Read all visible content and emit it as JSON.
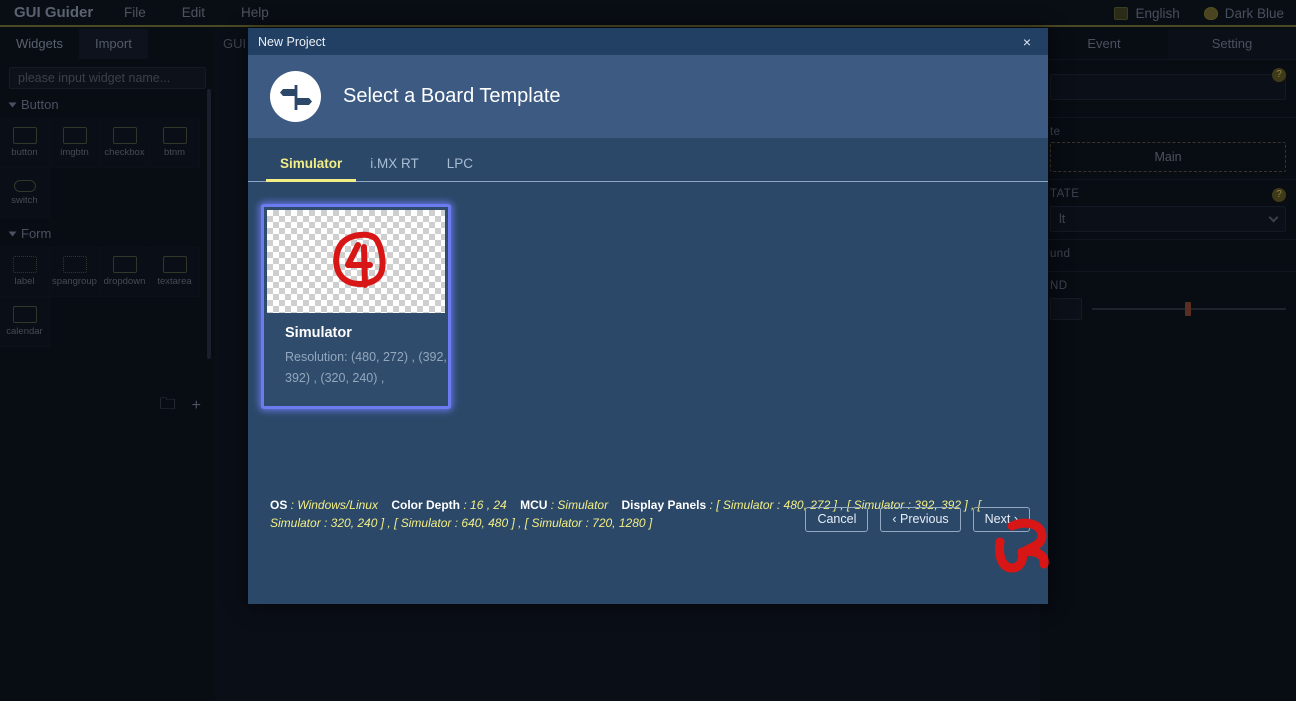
{
  "menubar": {
    "brand": "GUI Guider",
    "items": [
      "File",
      "Edit",
      "Help"
    ],
    "language": {
      "label": "English",
      "icon": "language-icon"
    },
    "theme": {
      "label": "Dark Blue",
      "icon": "palette-icon"
    }
  },
  "left_panel": {
    "tabs": [
      {
        "label": "Widgets",
        "active": true
      },
      {
        "label": "Import",
        "active": false
      }
    ],
    "search_placeholder": "please input widget name...",
    "groups": [
      {
        "name": "Button",
        "widgets": [
          {
            "label": "button",
            "icon": "button-icon"
          },
          {
            "label": "imgbtn",
            "icon": "imgbtn-icon"
          },
          {
            "label": "checkbox",
            "icon": "checkbox-icon"
          },
          {
            "label": "btnm",
            "icon": "btnm-icon"
          },
          {
            "label": "switch",
            "icon": "switch-icon"
          }
        ]
      },
      {
        "name": "Form",
        "widgets": [
          {
            "label": "label",
            "icon": "label-icon"
          },
          {
            "label": "spangroup",
            "icon": "spangroup-icon"
          },
          {
            "label": "dropdown",
            "icon": "dropdown-icon"
          },
          {
            "label": "textarea",
            "icon": "textarea-icon"
          },
          {
            "label": "calendar",
            "icon": "calendar-icon"
          }
        ]
      }
    ],
    "footer_icons": [
      {
        "name": "open-folder-icon",
        "glyph": "🗀"
      },
      {
        "name": "add-icon",
        "glyph": "+"
      }
    ]
  },
  "canvas": {
    "tab_label": "GUI"
  },
  "right_panel": {
    "tabs": [
      {
        "label": "Event",
        "active": false
      },
      {
        "label": "Setting",
        "active": true
      }
    ],
    "fields": [
      {
        "label": "",
        "type": "input",
        "help": "?"
      },
      {
        "label": "te",
        "type": "dashed",
        "value": "Main"
      },
      {
        "label": "TATE",
        "type": "select",
        "value": "lt",
        "help": "?"
      },
      {
        "label": "und",
        "type": "text"
      },
      {
        "label": "ND",
        "type": "slider"
      }
    ]
  },
  "dialog": {
    "window_title": "New Project",
    "close_label": "×",
    "header_title": "Select a Board Template",
    "header_icon": "signpost-icon",
    "tabs": [
      {
        "label": "Simulator",
        "active": true
      },
      {
        "label": "i.MX RT",
        "active": false
      },
      {
        "label": "LPC",
        "active": false
      }
    ],
    "card": {
      "title": "Simulator",
      "description": "Resolution: (480, 272) , (392, 392) , (320, 240) ,",
      "selected": true,
      "annotation": "red-hand-drawn-4"
    },
    "info": {
      "os_key": "OS",
      "os_value": "Windows/Linux",
      "color_depth_key": "Color Depth",
      "color_depth_value": "16 , 24",
      "mcu_key": "MCU",
      "mcu_value": "Simulator",
      "panels_key": "Display Panels",
      "panels_value": "[ Simulator : 480, 272 ] , [ Simulator : 392, 392 ] , [ Simulator : 320, 240 ] , [ Simulator : 640, 480 ] , [ Simulator : 720, 1280 ]"
    },
    "buttons": [
      {
        "name": "cancel",
        "label": "Cancel"
      },
      {
        "name": "previous",
        "label": "‹ Previous"
      },
      {
        "name": "next",
        "label": "Next ›"
      }
    ]
  },
  "annotations": {
    "arrow_color": "#d81616",
    "arrow_target": "next-button"
  },
  "colors": {
    "dialog_bg": "#2b4868",
    "dialog_header": "#3c5a82",
    "dialog_titlebar": "#224063",
    "accent_yellow": "#f2ee86",
    "selection_glow": "#6d7bf0",
    "app_bg": "#090d15"
  }
}
